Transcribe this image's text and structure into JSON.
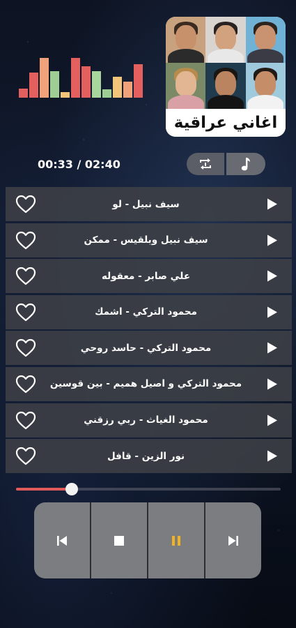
{
  "equalizer": {
    "levels": [
      0.22,
      0.62,
      0.98,
      0.65,
      0.14,
      0.98,
      0.78,
      0.65,
      0.2,
      0.52,
      0.4,
      0.82
    ],
    "colors": [
      "#e4605e",
      "#e4605e",
      "#f0a27a",
      "#9fce94",
      "#f2c57a",
      "#e4605e",
      "#e4605e",
      "#a9d69c",
      "#9fce94",
      "#f2c57a",
      "#f0a27a",
      "#e4605e"
    ]
  },
  "cover": {
    "title": "اغاني عراقية"
  },
  "player": {
    "time": "00:33 / 02:40",
    "progress": 0.21
  },
  "toggles": {
    "repeat_icon": "repeat-icon",
    "music_icon": "music-note-icon"
  },
  "tracks": [
    {
      "title": "سيف نبيل - لو"
    },
    {
      "title": "سيف نبيل وبلقيس - ممكن"
    },
    {
      "title": "علي صابر - معقوله"
    },
    {
      "title": "محمود التركي - اشمك"
    },
    {
      "title": "محمود التركي - حاسد روحي"
    },
    {
      "title": "محمود التركي و اصيل هميم - بين قوسين"
    },
    {
      "title": "محمود الغياث - ربي رزقني"
    },
    {
      "title": "نور الزين - قافل"
    }
  ],
  "controls": {
    "items": [
      "previous-icon",
      "stop-icon",
      "pause-icon",
      "next-icon"
    ],
    "active_color": "#f0b323"
  },
  "colors": {
    "accent": "#e05a5a",
    "track_bg": "#3e4046"
  }
}
